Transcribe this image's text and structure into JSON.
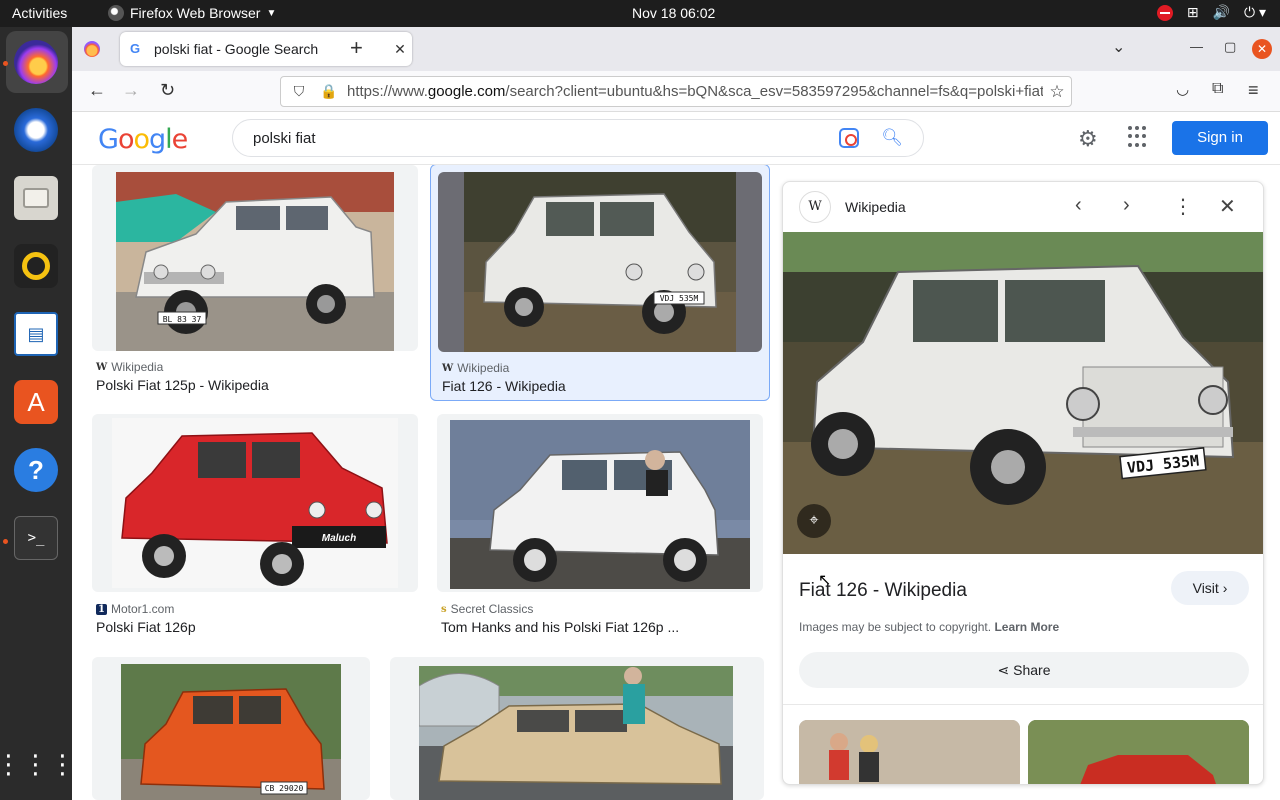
{
  "topbar": {
    "activities": "Activities",
    "app_name": "Firefox Web Browser",
    "clock": "Nov 18  06:02"
  },
  "browser": {
    "tab_title": "polski fiat - Google Search",
    "url_prefix": "https://www.",
    "url_domain": "google.com",
    "url_rest": "/search?client=ubuntu&hs=bQN&sca_esv=583597295&channel=fs&q=polski+fiat"
  },
  "google": {
    "logo_letters": [
      "G",
      "o",
      "o",
      "g",
      "l",
      "e"
    ],
    "query": "polski fiat",
    "signin_label": "Sign in"
  },
  "results": [
    {
      "source": "Wikipedia",
      "source_icon": "W",
      "caption": "Polski Fiat 125p - Wikipedia",
      "car_color": "#f0f0ee"
    },
    {
      "source": "Wikipedia",
      "source_icon": "W",
      "caption": "Fiat 126 - Wikipedia",
      "car_color": "#e9e9e6",
      "selected": true
    },
    {
      "source": "Motor1.com",
      "source_icon": "1",
      "caption": "Polski Fiat 126p",
      "car_color": "#d9262a"
    },
    {
      "source": "Secret Classics",
      "source_icon": "s",
      "caption": "Tom Hanks and his Polski Fiat 126p ...",
      "car_color": "#f2f2f2"
    },
    {
      "source": "",
      "source_icon": "",
      "caption": "",
      "car_color": "#e4571f"
    },
    {
      "source": "",
      "source_icon": "",
      "caption": "",
      "car_color": "#d8c29a"
    }
  ],
  "plate_texts": {
    "result1": "BL 83 37",
    "result2": "VDJ 535M",
    "result3": "Maluch",
    "result5": "CB 29020",
    "panel": "VDJ 535M"
  },
  "panel": {
    "site": "Wikipedia",
    "site_icon": "W",
    "title": "Fiat 126 - Wikipedia",
    "visit_label": "Visit",
    "copyright": "Images may be subject to copyright.",
    "learn_more": "Learn More",
    "share_label": "Share"
  },
  "icons": {
    "back": "back-arrow-icon",
    "forward": "forward-arrow-icon",
    "reload": "reload-icon",
    "settings": "gear-icon",
    "apps": "apps-grid-icon"
  },
  "colors": {
    "accent": "#1a73e8",
    "selected_bg": "#e8f0fe",
    "ubuntu_orange": "#e95420"
  }
}
